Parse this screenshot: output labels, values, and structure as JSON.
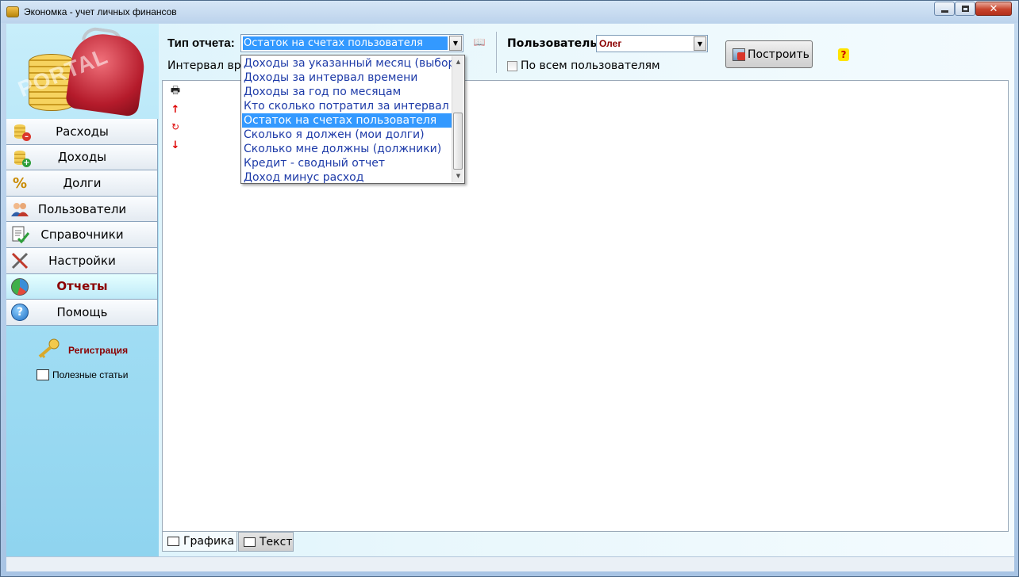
{
  "window": {
    "title": "Экономка - учет личных финансов",
    "controls": {
      "minimize": "–",
      "maximize": "□",
      "close": "✕"
    }
  },
  "sidebar": {
    "logo_watermark": "PORTAL",
    "items": [
      {
        "label": "Расходы",
        "icon": "coins-minus-icon",
        "active": false
      },
      {
        "label": "Доходы",
        "icon": "coins-plus-icon",
        "active": false
      },
      {
        "label": "Долги",
        "icon": "percent-icon",
        "active": false
      },
      {
        "label": "Пользователи",
        "icon": "users-icon",
        "active": false
      },
      {
        "label": "Справочники",
        "icon": "directory-check-icon",
        "active": false
      },
      {
        "label": "Настройки",
        "icon": "tools-icon",
        "active": false
      },
      {
        "label": "Отчеты",
        "icon": "pie-chart-icon",
        "active": true
      },
      {
        "label": "Помощь",
        "icon": "help-icon",
        "active": false
      }
    ],
    "registration": "Регистрация",
    "useful_articles": "Полезные статьи"
  },
  "toolbar": {
    "report_type_label": "Тип отчета:",
    "report_type_value": "Остаток на счетах пользователя",
    "interval_label": "Интервал времени",
    "user_label": "Пользователь:",
    "user_value": "Олег",
    "all_users_label": "По всем пользователям",
    "all_users_checked": false,
    "build_button": "Построить",
    "help_glyph": "?"
  },
  "report_tools": {
    "print": "🖶",
    "up": "↑",
    "refresh": "↻",
    "down": "↓"
  },
  "tabs": {
    "graphics": "Графика",
    "text": "Текст",
    "active": "graphics"
  },
  "report_type_dropdown": {
    "options": [
      "Доходы за указанный месяц (выбор)",
      "Доходы за интервал времени",
      "Доходы за год по месяцам",
      "Кто сколько потратил за интервал",
      "Остаток на счетах пользователя",
      "Сколько я должен (мои долги)",
      "Сколько мне должны (должники)",
      "Кредит - сводный отчет",
      "Доход минус расход"
    ],
    "selected_index": 4
  },
  "colors": {
    "accent": "#3399ff",
    "active_nav_text": "#8b0000",
    "option_text": "#1e3ba8"
  }
}
